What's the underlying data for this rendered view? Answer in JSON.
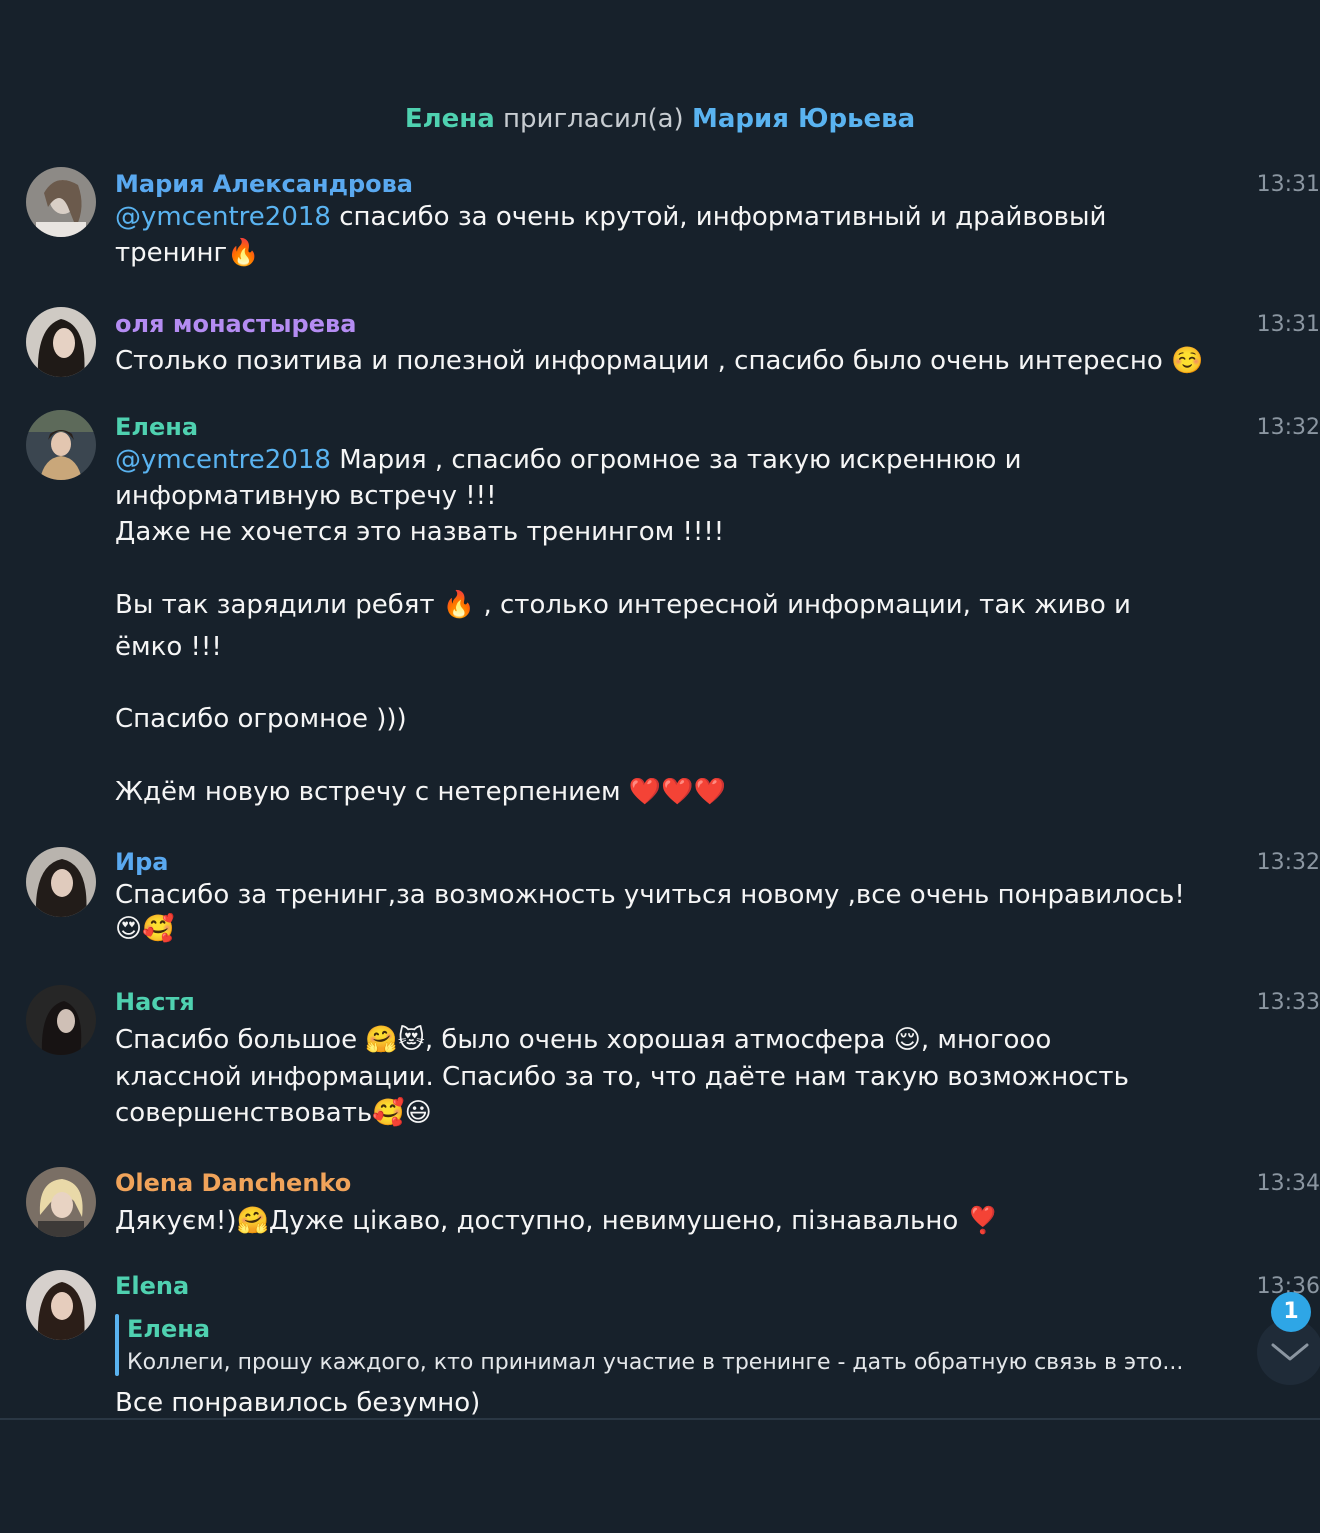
{
  "colors": {
    "background": "#17212b",
    "accent_link": "#5ab3f0",
    "name_green": "#4fd1b0",
    "name_blue": "#5aa9f0",
    "name_purple": "#b48cf2",
    "name_orange": "#f0a35a",
    "time": "#8b96a1"
  },
  "service_message": {
    "inviter": "Елена",
    "action": " пригласил(а) ",
    "invitee": "Мария Юрьева"
  },
  "messages": [
    {
      "author": "Мария Александрова",
      "time": "13:31",
      "lines": [
        {
          "mention": "@ymcentre2018",
          "text": " спасибо за очень крутой, информативный и драйвовый"
        },
        {
          "text": "тренинг",
          "emoji": "🔥"
        }
      ]
    },
    {
      "author": "оля монастырева",
      "time": "13:31",
      "lines": [
        {
          "text": "Столько позитива и полезной информации , спасибо было очень интересно ",
          "emoji": "☺️"
        }
      ]
    },
    {
      "author": "Елена",
      "time": "13:32",
      "lines": [
        {
          "mention": "@ymcentre2018",
          "text": " Мария , спасибо огромное за такую искреннюю и"
        },
        {
          "text": "информативную встречу !!!"
        },
        {
          "text": "Даже не хочется это назвать тренингом !!!!"
        },
        {
          "text": "Вы так зарядили ребят ",
          "emoji": "🔥",
          "text_after": " , столько интересной информации, так живо и"
        },
        {
          "text": "ёмко !!!"
        },
        {
          "text": "Спасибо огромное )))"
        },
        {
          "text": "Ждём новую встречу с нетерпением ",
          "emoji": "❤️❤️❤️"
        }
      ]
    },
    {
      "author": "Ира",
      "time": "13:32",
      "lines": [
        {
          "text": "Спасибо за тренинг,за возможность учиться новому ,все очень понравилось!"
        },
        {
          "emoji": "😍🥰"
        }
      ]
    },
    {
      "author": "Настя",
      "time": "13:33",
      "lines": [
        {
          "text": "Спасибо большое ",
          "emoji": "🤗😻",
          "text_after": ", было очень хорошая атмосфера ",
          "emoji_after": "😌",
          "text_end": ", многооо"
        },
        {
          "text": "классной информации. Спасибо за то, что даёте нам такую возможность"
        },
        {
          "text": "совершенствовать",
          "emoji": "🥰😃"
        }
      ]
    },
    {
      "author": "Olena Danchenko",
      "time": "13:34",
      "lines": [
        {
          "text": "Дякуєм!)",
          "emoji": "🤗",
          "text_after": "Дуже цікаво, доступно, невимушено, пізнавально ",
          "emoji_after": "❣️"
        }
      ]
    },
    {
      "author": "Elena",
      "time": "13:36",
      "reply": {
        "author": "Елена",
        "text": "Коллеги, прошу каждого, кто принимал участие в тренинге - дать обратную связь в это..."
      },
      "lines": [
        {
          "text": "Все понравилось безумно)"
        }
      ]
    }
  ],
  "scroll_down": {
    "icon": "chevron-down-icon",
    "unread_count": "1"
  }
}
